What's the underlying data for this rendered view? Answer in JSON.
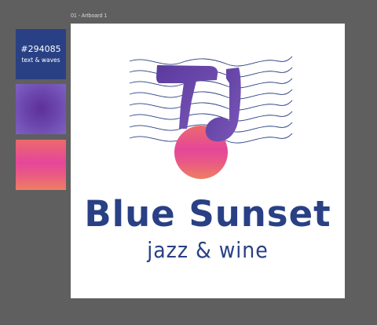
{
  "artboard": {
    "label": "01 - Artboard 1"
  },
  "swatches": [
    {
      "hex": "#294085",
      "description": "text & waves",
      "color": "#294085"
    },
    {
      "kind": "radial-gradient",
      "colors": [
        "#5e2f9a",
        "#7f62c2"
      ]
    },
    {
      "kind": "linear-gradient",
      "colors": [
        "#ec6a6c",
        "#e5469a",
        "#ed7f63"
      ]
    }
  ],
  "logo": {
    "title": "Blue Sunset",
    "tagline": "jazz & wine",
    "text_color": "#294085",
    "wave_color": "#294085",
    "note_color": "#6a45ac",
    "sun_colors": [
      "#e5469a",
      "#ed7f63"
    ],
    "icons": [
      "wave-lines",
      "music-note-icon",
      "sun-circle"
    ]
  }
}
